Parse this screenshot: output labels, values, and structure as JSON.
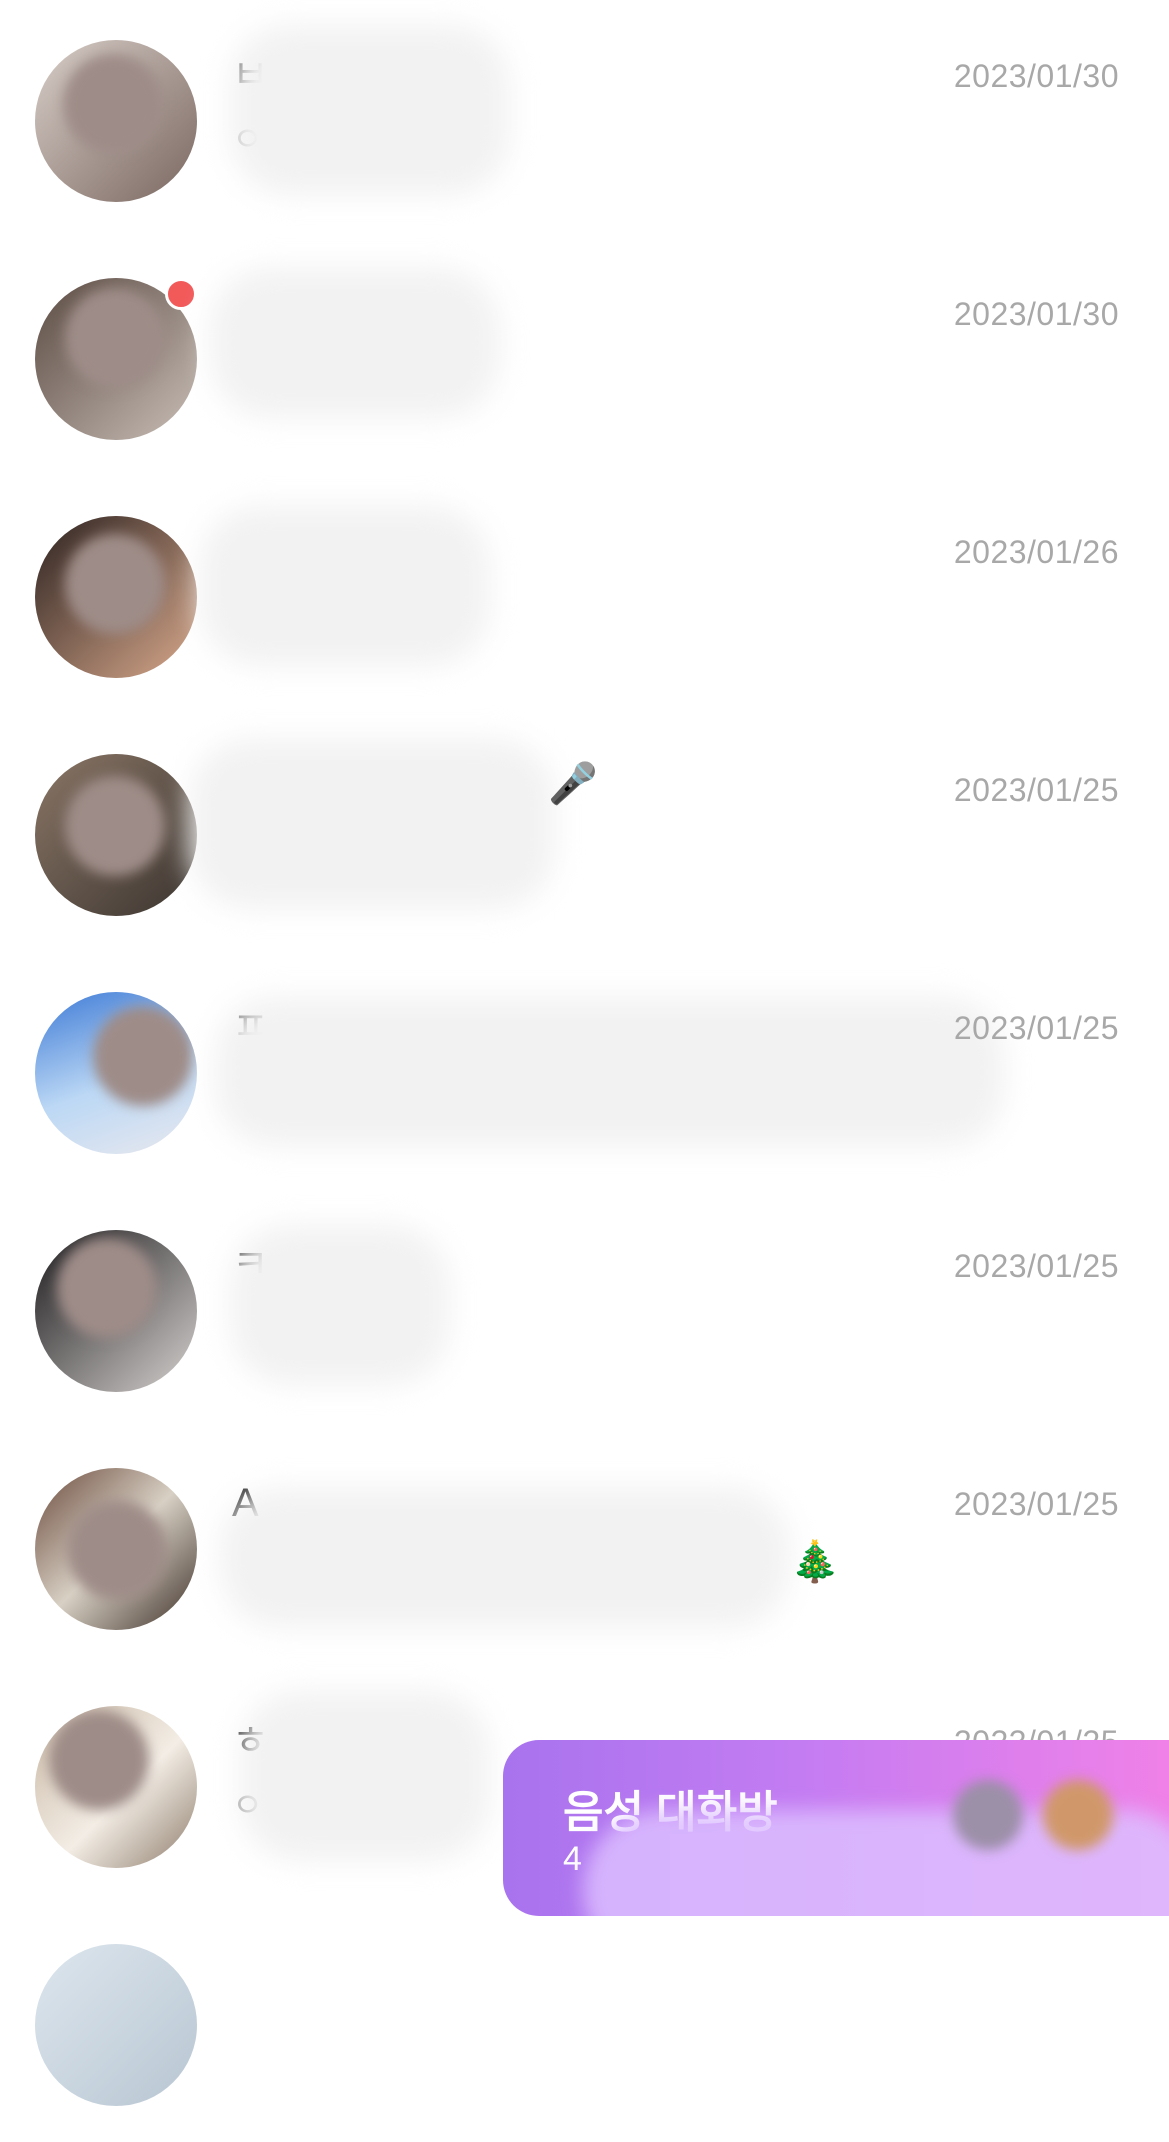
{
  "conversations": [
    {
      "name": "ㅂ",
      "preview": "ㅇ",
      "date": "2023/01/30",
      "unread": false,
      "emoji": ""
    },
    {
      "name": "",
      "preview": "",
      "date": "2023/01/30",
      "unread": true,
      "emoji": ""
    },
    {
      "name": "",
      "preview": "",
      "date": "2023/01/26",
      "unread": false,
      "emoji": ""
    },
    {
      "name": "",
      "preview": "",
      "date": "2023/01/25",
      "unread": false,
      "emoji": "🎤"
    },
    {
      "name": "ㅍ",
      "preview": "",
      "date": "2023/01/25",
      "unread": false,
      "emoji": ""
    },
    {
      "name": "ㅋ",
      "preview": "",
      "date": "2023/01/25",
      "unread": false,
      "emoji": ""
    },
    {
      "name": "A",
      "preview": "",
      "date": "2023/01/25",
      "unread": false,
      "emoji": "🎄"
    },
    {
      "name": "ㅎ",
      "preview": "ㅇ",
      "date": "2023/01/25",
      "unread": false,
      "emoji": ""
    }
  ],
  "banner": {
    "title": "음성 대화방",
    "subtitle": "4"
  },
  "colors": {
    "unread_dot": "#f25a5a",
    "banner_start": "#a873ee",
    "banner_end": "#f081e8",
    "date_text": "#a8a8a8"
  }
}
